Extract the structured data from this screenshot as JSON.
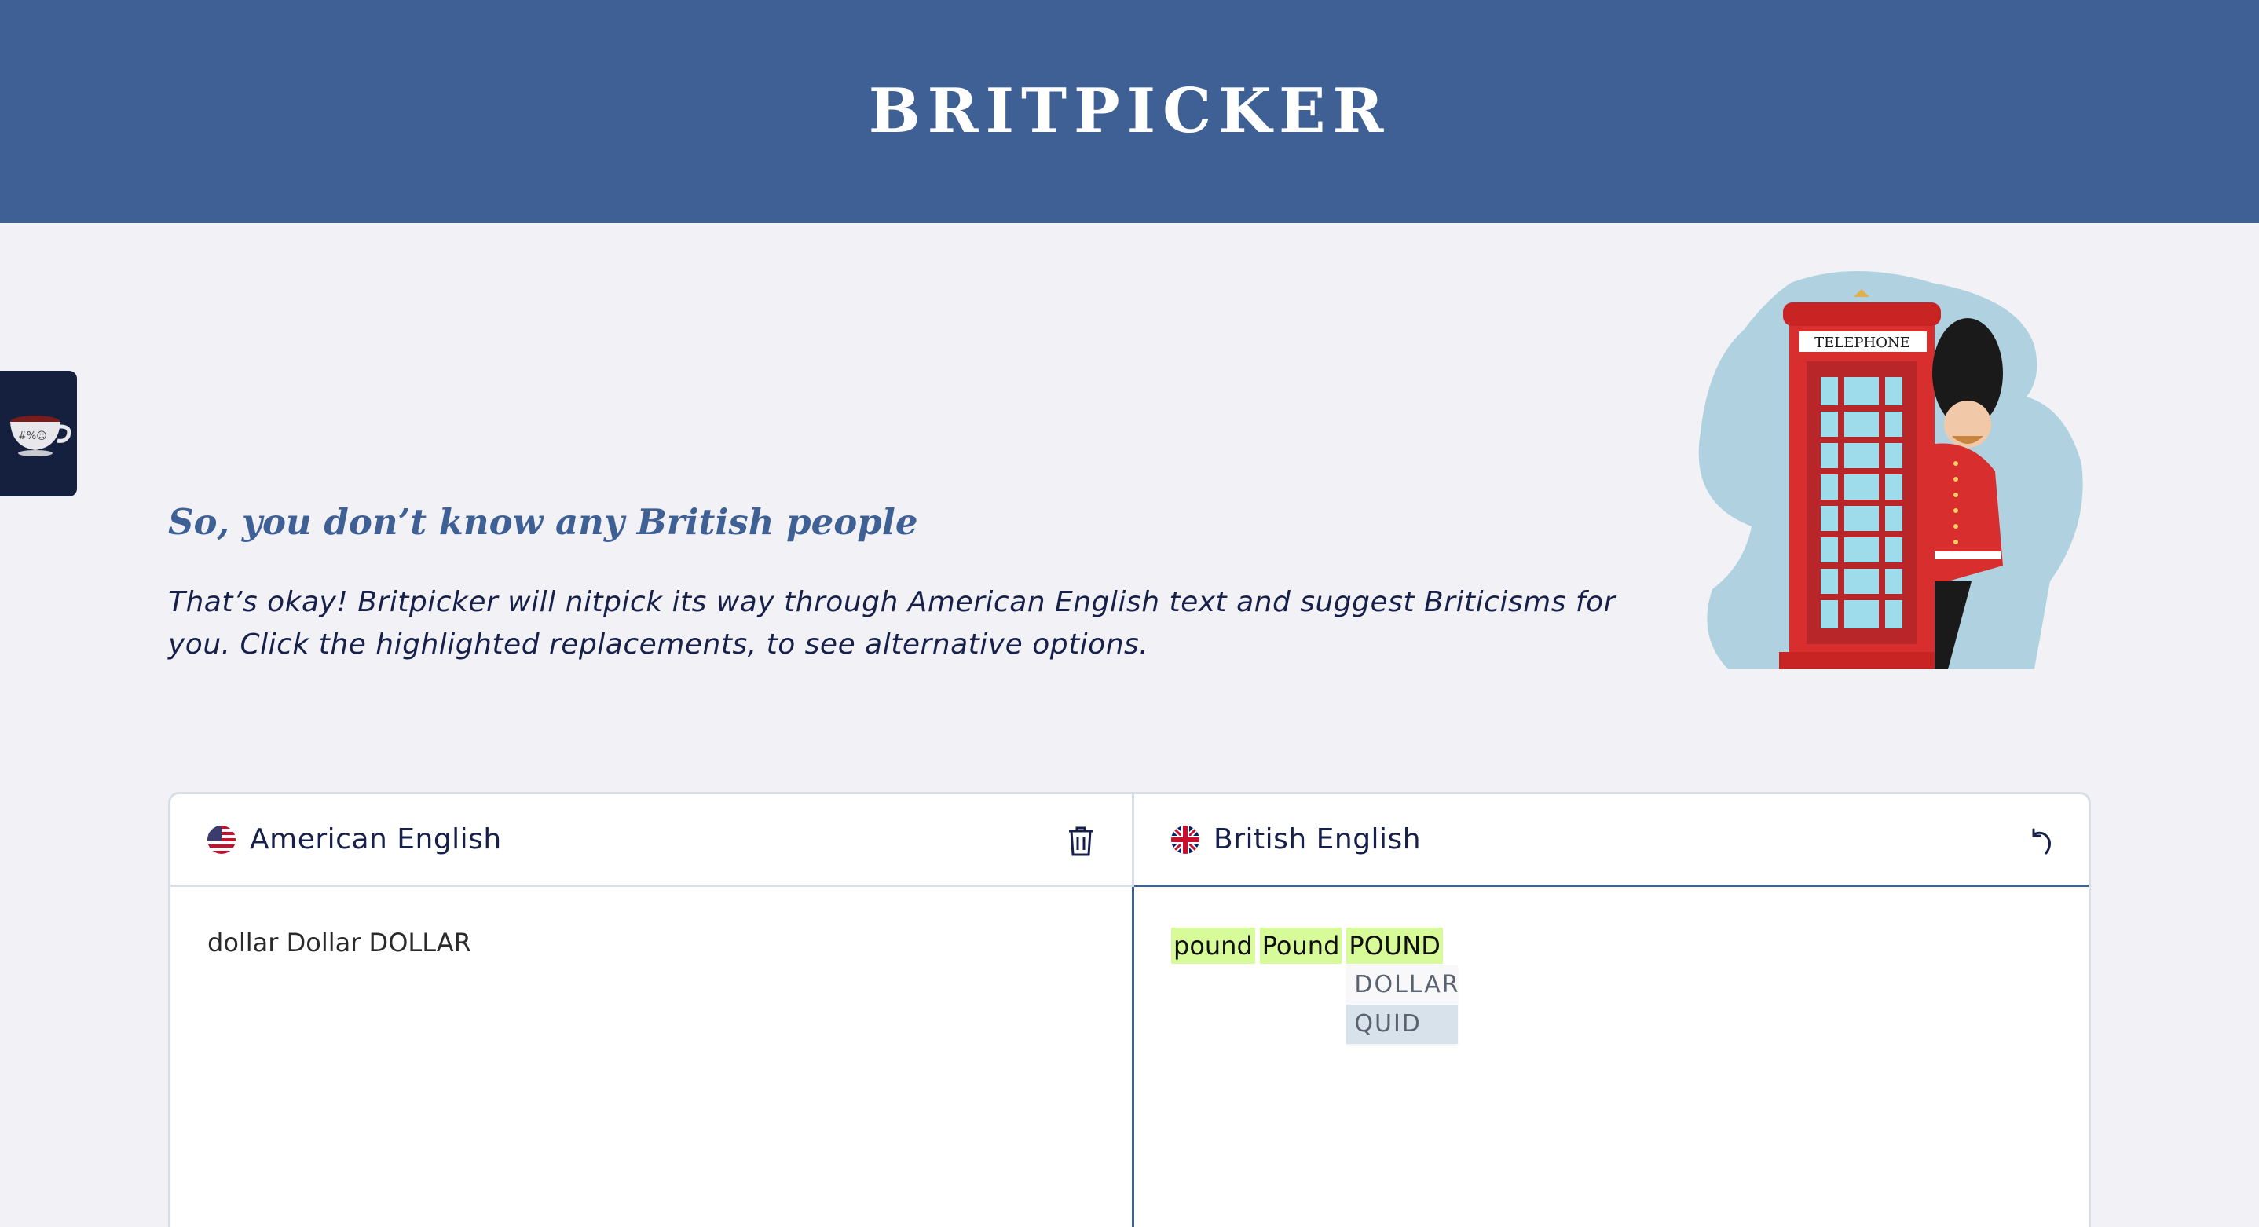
{
  "header": {
    "logo": "BRITPICKER"
  },
  "side_tab": {
    "icon": "teacup-icon"
  },
  "intro": {
    "title": "So, you don’t know any British people",
    "body": "That’s okay! Britpicker will nitpick its way through American English text and suggest Briticisms for you. Click the highlighted replacements, to see alternative options."
  },
  "illustration": {
    "sign_text": "TELEPHONE"
  },
  "panels": {
    "american": {
      "title": "American English",
      "flag": "us-flag-icon",
      "action_icon": "trash-icon",
      "text": "dollar Dollar DOLLAR"
    },
    "british": {
      "title": "British English",
      "flag": "uk-flag-icon",
      "action_icon": "undo-icon",
      "words": [
        "pound",
        "Pound",
        "POUND"
      ],
      "dropdown": {
        "options": [
          "DOLLAR",
          "QUID"
        ],
        "active": "QUID"
      }
    }
  },
  "colors": {
    "brand": "#3f6094",
    "highlight": "#d8fb9a",
    "background": "#f2f2f6",
    "dark": "#14203d"
  }
}
